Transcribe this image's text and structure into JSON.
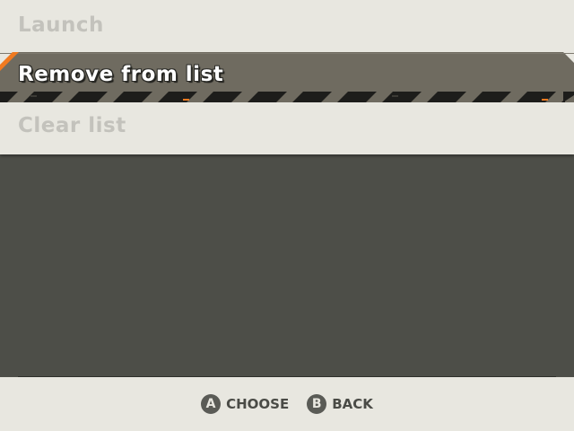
{
  "menu": {
    "items": [
      {
        "label": "Launch",
        "selected": false
      },
      {
        "label": "Remove from list",
        "selected": true
      },
      {
        "label": "Clear list",
        "selected": false
      }
    ]
  },
  "footer": {
    "choose": {
      "button": "A",
      "label": "CHOOSE"
    },
    "back": {
      "button": "B",
      "label": "BACK"
    }
  },
  "colors": {
    "panel_bg": "#e8e7e0",
    "screen_bg": "#4d4e48",
    "highlight": "#6f6b60",
    "accent": "#f07a20",
    "item_text": "#c3c2bc"
  }
}
